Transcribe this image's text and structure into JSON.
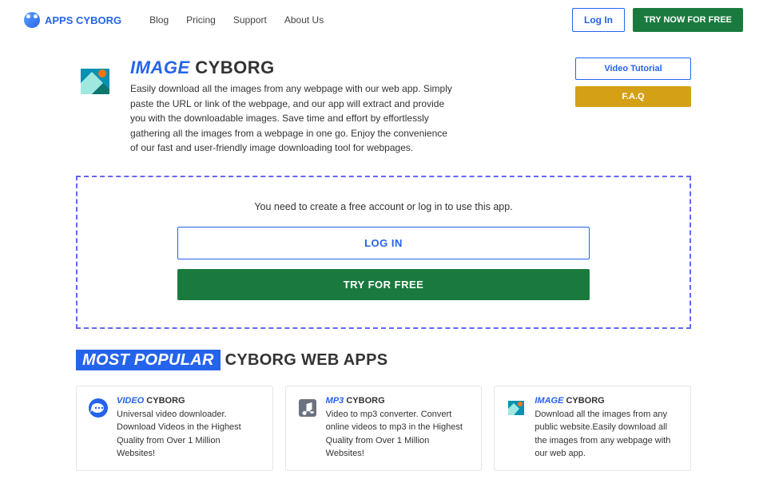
{
  "nav": {
    "brand_bold": "APPS",
    "brand_rest": "CYBORG",
    "links": [
      "Blog",
      "Pricing",
      "Support",
      "About Us"
    ],
    "login": "Log In",
    "try": "TRY NOW FOR FREE"
  },
  "hero": {
    "title_blue": "IMAGE",
    "title_rest": " CYBORG",
    "desc": "Easily download all the images from any webpage with our web app. Simply paste the URL or link of the webpage, and our app will extract and provide you with the downloadable images. Save time and effort by effortlessly gathering all the images from a webpage in one go. Enjoy the convenience of our fast and user-friendly image downloading tool for webpages.",
    "video_btn": "Video Tutorial",
    "faq_btn": "F.A.Q"
  },
  "cta": {
    "prompt": "You need to create a free account or log in to use this app.",
    "login": "LOG IN",
    "try": "TRY FOR FREE"
  },
  "section": {
    "highlight": "MOST POPULAR",
    "rest": " CYBORG WEB APPS"
  },
  "cards": [
    {
      "title_blue": "VIDEO",
      "title_rest": " CYBORG",
      "desc": "Universal video downloader. Download Videos in the Highest Quality from Over 1 Million Websites!"
    },
    {
      "title_blue": "MP3",
      "title_rest": " CYBORG",
      "desc": "Video to mp3 converter. Convert online videos to mp3 in the Highest Quality from Over 1 Million Websites!"
    },
    {
      "title_blue": "IMAGE",
      "title_rest": " CYBORG",
      "desc": "Download all the images from any public website.Easily download all the images from any webpage with our web app."
    }
  ]
}
